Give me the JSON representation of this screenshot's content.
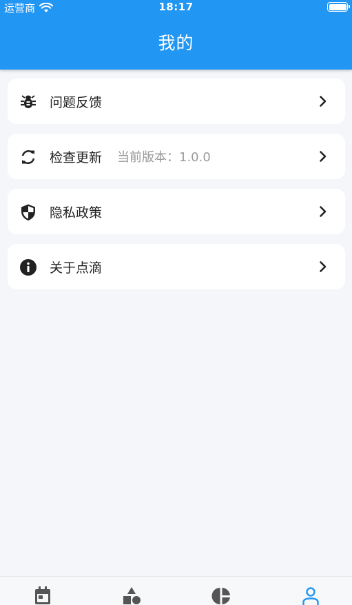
{
  "status_bar": {
    "carrier": "运营商",
    "time": "18:17"
  },
  "header": {
    "title": "我的"
  },
  "menu": {
    "items": [
      {
        "label": "问题反馈",
        "icon": "bug-icon"
      },
      {
        "label": "检查更新",
        "sub": "当前版本：1.0.0",
        "icon": "refresh-icon"
      },
      {
        "label": "隐私政策",
        "icon": "shield-icon"
      },
      {
        "label": "关于点滴",
        "icon": "info-icon"
      }
    ]
  },
  "tabbar": {
    "tabs": [
      {
        "icon": "calendar-icon",
        "active": false
      },
      {
        "icon": "shapes-icon",
        "active": false
      },
      {
        "icon": "pie-chart-icon",
        "active": false
      },
      {
        "icon": "person-icon",
        "active": true
      }
    ]
  },
  "colors": {
    "primary": "#2196f3",
    "background": "#f4f6f9",
    "card": "#ffffff",
    "text": "#222222",
    "muted": "#9a9a9a",
    "tab_inactive": "#555555",
    "tab_active": "#2196f3"
  }
}
